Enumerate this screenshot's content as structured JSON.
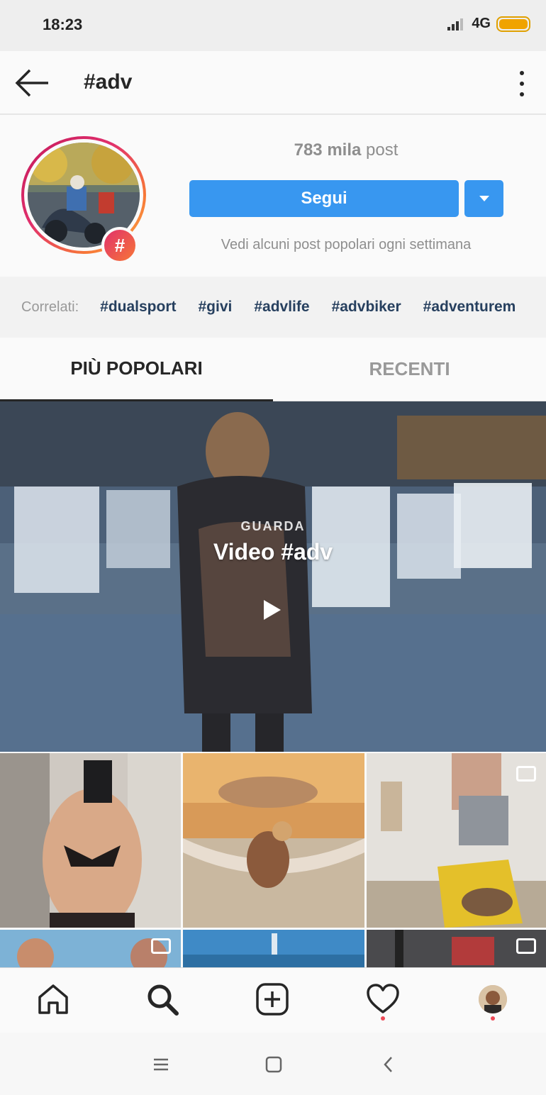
{
  "status_bar": {
    "time": "18:23",
    "network": "4G",
    "icons": [
      "signal-icon",
      "battery-icon"
    ]
  },
  "header": {
    "title": "#adv",
    "icons": [
      "back-arrow-icon",
      "more-options-icon"
    ]
  },
  "profile": {
    "post_count_bold": "783 mila",
    "post_count_suffix": "post",
    "follow_label": "Segui",
    "follow_hint": "Vedi alcuni post popolari ogni settimana",
    "badge_symbol": "#"
  },
  "related": {
    "label": "Correlati:",
    "tags": [
      "#dualsport",
      "#givi",
      "#advlife",
      "#advbiker",
      "#adventurem"
    ]
  },
  "tabs": {
    "popular": "PIÙ POPOLARI",
    "recent": "RECENTI"
  },
  "video": {
    "kicker": "GUARDA",
    "title": "Video #adv"
  },
  "bottom_nav": {
    "icons": [
      "home-icon",
      "search-icon",
      "new-post-icon",
      "activity-heart-icon",
      "profile-avatar"
    ]
  },
  "system_nav": {
    "icons": [
      "menu-icon",
      "home-square-icon",
      "back-icon"
    ]
  },
  "colors": {
    "accent_blue": "#3897f0",
    "related_tag": "#27405f",
    "notification_dot": "#ed4956"
  }
}
